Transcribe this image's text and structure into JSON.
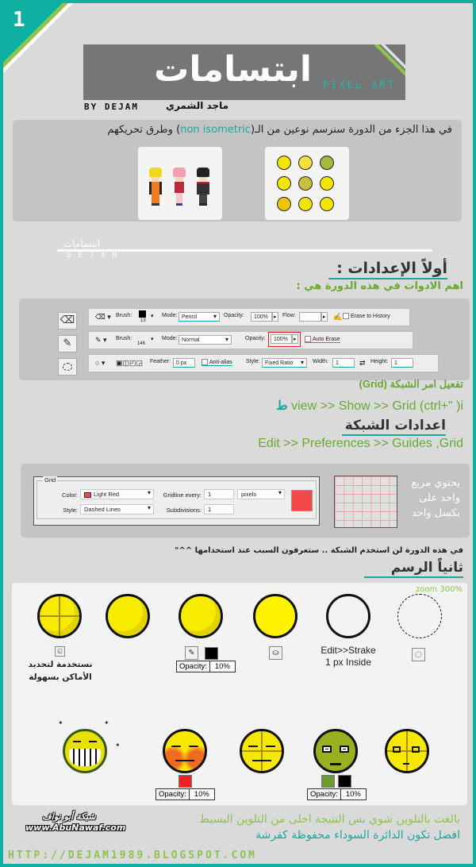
{
  "page": {
    "number": "1"
  },
  "title": {
    "arabic": "ابتسامات",
    "english": "PIXEL ART",
    "byline_en": "BY DEJAM",
    "byline_ar": "ماجد الشمري"
  },
  "intro": {
    "text_before": "في هذا الجزء من الدورة سنرسم نوعين من الـ(",
    "highlight": "non isometric",
    "text_after": ") وطرق تحريكهم",
    "thumbnails": [
      "characters-sprites",
      "smiley-faces"
    ]
  },
  "divider": {
    "arabic": "ابتسامات",
    "english": "DEJAM"
  },
  "settings": {
    "heading": "أولاً الإعدادات :",
    "subheading": "اهم الادوات في هذه الدورة هي :"
  },
  "tools": {
    "eraser": {
      "brush_label": "Brush:",
      "brush_size": "13",
      "mode_label": "Mode:",
      "mode_value": "Pencil",
      "opacity_label": "Opacity:",
      "opacity_value": "100%",
      "flow_label": "Flow:",
      "flow_value": "",
      "erase_history_label": "Erase to History"
    },
    "pencil": {
      "brush_label": "Brush:",
      "brush_size": "146",
      "mode_label": "Mode:",
      "mode_value": "Normal",
      "opacity_label": "Opacity:",
      "opacity_value": "100%",
      "auto_erase_label": "Auto Erase"
    },
    "ellipse_marquee": {
      "feather_label": "Feather:",
      "feather_value": "0 px",
      "anti_alias_label": "Anti-alias",
      "style_label": "Style:",
      "style_value": "Fixed Ratio",
      "width_label": "Width:",
      "width_value": "1",
      "height_label": "Height:",
      "height_value": "1"
    }
  },
  "grid_enable": {
    "title": "تفعيل امر الشبكة (Grid)",
    "path_suffix": "ط",
    "path": "view >> Show >> Grid (ctrl+\"   )i"
  },
  "grid_settings": {
    "heading": "اعدادات الشبكة",
    "path": "Edit >> Preferences >> Guides ,Grid",
    "dialog": {
      "legend": "Grid",
      "color_label": "Color:",
      "color_value": "Light Red",
      "style_label": "Style:",
      "style_value": "Dashed Lines",
      "gridline_label": "Gridline every:",
      "gridline_value": "1",
      "unit_value": "pixels",
      "subdivisions_label": "Subdivisions:",
      "subdivisions_value": "1",
      "swatch_color": "#f44848"
    },
    "note": "يحتوي مربع واحد على بكسل واحد"
  },
  "grid_note": "في هذه الدورة لن استخدم الشبكة .. ستعرفون السبب عند استخدامها ^^\"",
  "drawing": {
    "heading": "ثانياً الرسم",
    "zoom_label": "zoom 300%",
    "caption_guides": "نستخدمة لتحديد الأماكن بسهولة",
    "opacity_label": "Opacity:",
    "opacity_value": "10%",
    "stroke_caption_1": "Edit>>Strake",
    "stroke_caption_2": "1 px  Inside",
    "swatches": {
      "black": "#000000",
      "red": "#ee2222",
      "green": "#6e9a32"
    }
  },
  "footer": {
    "line1": "بالغت بالتلوين شوي بس النتيجة احلى من التلوين البسيط",
    "line2": "افضل تكون الدائرة السوداء محفوظة كفرشة",
    "logo_ar": "شبكة أبو نواف",
    "logo_en": "www.AbuNawaf.com",
    "url": "HTTP://DEJAM1989.BLOGSPOT.COM"
  },
  "colors": {
    "teal": "#0fb0a2",
    "green": "#8cc44c",
    "dark_green": "#6aa832",
    "panel": "#c4c4c4",
    "bg": "#dadada"
  }
}
